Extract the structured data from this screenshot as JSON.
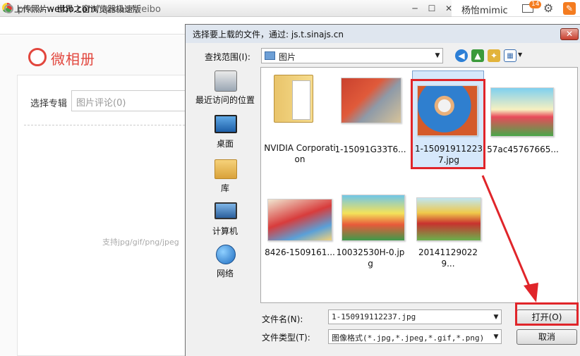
{
  "browser": {
    "title": "上传照片 - 世界之窗浏览器极速版",
    "url_prefix": "photo.",
    "url_domain": "weibo.com",
    "url_path": "/upload/weibo",
    "minimize": "─",
    "maximize": "☐",
    "close": "✕"
  },
  "topbar": {
    "username": "杨怡mimic",
    "mail_count": "14"
  },
  "weibo_page": {
    "logo_text": "微相册",
    "album_label": "选择专辑",
    "album_value": "图片评论(0)",
    "support_hint": "支持jpg/gif/png/jpeg"
  },
  "dialog": {
    "title": "选择要上载的文件，通过: js.t.sinajs.cn",
    "close_label": "✕",
    "look_in_label": "查找范围(I):",
    "look_in_value": "图片",
    "places": [
      {
        "label": "最近访问的位置"
      },
      {
        "label": "桌面"
      },
      {
        "label": "库"
      },
      {
        "label": "计算机"
      },
      {
        "label": "网络"
      }
    ],
    "files": [
      {
        "name": "NVIDIA Corporation"
      },
      {
        "name": "1-15091G33T6..."
      },
      {
        "name": "1-150919112237.jpg"
      },
      {
        "name": "57ac45767665..."
      },
      {
        "name": "8426-1509161..."
      },
      {
        "name": "10032530H-0.jpg"
      },
      {
        "name": "201411290229..."
      }
    ],
    "filename_label": "文件名(N):",
    "filename_value": "1-150919112237.jpg",
    "filetype_label": "文件类型(T):",
    "filetype_value": "图像格式(*.jpg,*.jpeg,*.gif,*.png)",
    "open_button": "打开(O)",
    "cancel_button": "取消"
  },
  "colors": {
    "annotation_red": "#e0252a",
    "weibo_red": "#e2463d",
    "selection_blue": "#d6e8fb"
  }
}
